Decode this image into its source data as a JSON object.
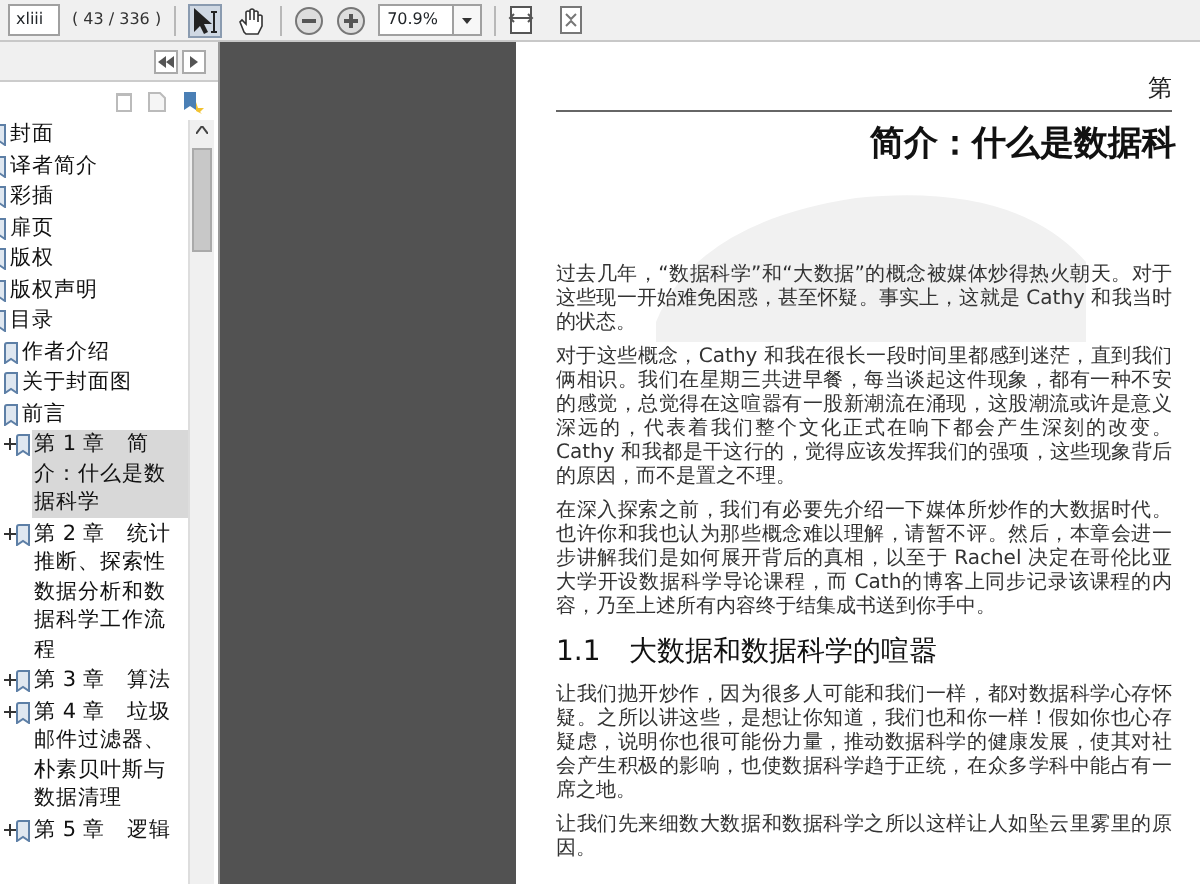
{
  "toolbar": {
    "page_field": "xliii",
    "page_count": "( 43 / 336 )",
    "tools": [
      {
        "kind": "select",
        "selected": true
      },
      {
        "kind": "hand",
        "selected": false
      }
    ],
    "zoom_field": "70.9%"
  },
  "bookmarks": [
    {
      "label": "封面",
      "selected": false
    },
    {
      "label": "译者简介",
      "selected": false
    },
    {
      "label": "彩插",
      "selected": false
    },
    {
      "label": "扉页",
      "selected": false
    },
    {
      "label": "版权",
      "selected": false
    },
    {
      "label": "版权声明",
      "selected": false
    },
    {
      "label": "目录",
      "selected": false,
      "children": [
        {
          "label": "作者介绍",
          "selected": false
        },
        {
          "label": "关于封面图",
          "selected": false
        },
        {
          "label": "前言",
          "selected": false
        },
        {
          "label": "第 1 章　简介：什么是数据科学",
          "selected": true,
          "expanded": false
        },
        {
          "label": "第 2 章　统计推断、探索性数据分析和数据科学工作流程",
          "selected": false,
          "expanded": false
        },
        {
          "label": "第 3 章　算法",
          "selected": false,
          "expanded": false
        },
        {
          "label": "第 4 章　垃圾邮件过滤器、朴素贝叶斯与数据清理",
          "selected": false,
          "expanded": false
        },
        {
          "label": "第 5 章　逻辑",
          "selected": false,
          "expanded": false
        }
      ]
    }
  ],
  "page": {
    "running_head": "第",
    "chapter_title": "简介：什么是数据科",
    "blocks": [
      {
        "kind": "paragraph",
        "text": "过去几年，“数据科学”和“大数据”的概念被媒体炒得热火朝天。对于这些现一开始难免困惑，甚至怀疑。事实上，这就是 Cathy 和我当时的状态。"
      },
      {
        "kind": "paragraph",
        "text": "对于这些概念，Cathy 和我在很长一段时间里都感到迷茫，直到我们俩相识。我们在星期三共进早餐，每当谈起这件现象，都有一种不安的感觉，总觉得在这喧嚣有一股新潮流在涌现，这股潮流或许是意义深远的，代表着我们整个文化正式在响下都会产生深刻的改变。Cathy 和我都是干这行的，觉得应该发挥我们的强项，这些现象背后的原因，而不是置之不理。"
      },
      {
        "kind": "paragraph",
        "text": "在深入探索之前，我们有必要先介绍一下媒体所炒作的大数据时代。也许你和我也认为那些概念难以理解，请暂不评。然后，本章会进一步讲解我们是如何展开背后的真相，以至于 Rachel 决定在哥伦比亚大学开设数据科学导论课程，而 Cath的博客上同步记录该课程的内容，乃至上述所有内容终于结集成书送到你手中。"
      },
      {
        "kind": "heading",
        "number": "1.1",
        "text": "大数据和数据科学的喧嚣"
      },
      {
        "kind": "paragraph",
        "text": "让我们抛开炒作，因为很多人可能和我们一样，都对数据科学心存怀疑。之所以讲这些，是想让你知道，我们也和你一样！假如你也心存疑虑，说明你也很可能份力量，推动数据科学的健康发展，使其对社会产生积极的影响，也使数据科学趋于正统，在众多学科中能占有一席之地。"
      },
      {
        "kind": "paragraph",
        "text": "让我们先来细数大数据和数据科学之所以这样让人如坠云里雾里的原因。"
      }
    ]
  }
}
